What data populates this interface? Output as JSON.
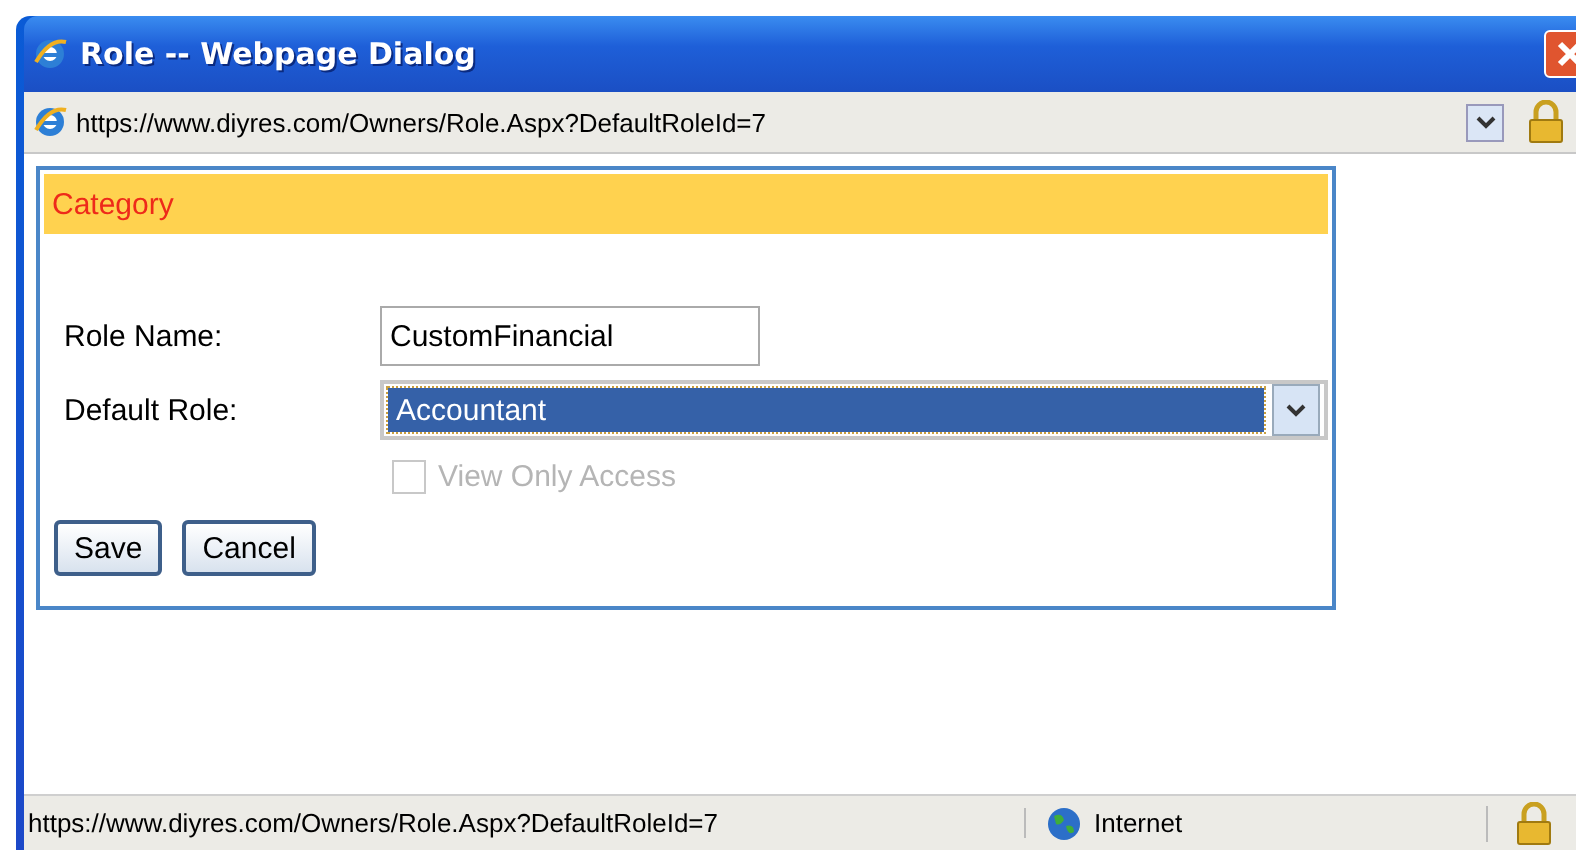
{
  "window": {
    "title": "Role -- Webpage Dialog"
  },
  "address_bar": {
    "url": "https://www.diyres.com/Owners/Role.Aspx?DefaultRoleId=7"
  },
  "panel": {
    "title": "Category"
  },
  "fields": [
    {
      "kind": "text",
      "label": "Role Name:",
      "value": "CustomFinancial"
    },
    {
      "kind": "select",
      "label": "Default Role:",
      "value": "Accountant",
      "selected": true
    }
  ],
  "checkbox": {
    "label": "View Only Access",
    "checked": false,
    "disabled": true
  },
  "buttons": [
    "Save",
    "Cancel"
  ],
  "status_bar": {
    "url": "https://www.diyres.com/Owners/Role.Aspx?DefaultRoleId=7",
    "zone": "Internet"
  }
}
